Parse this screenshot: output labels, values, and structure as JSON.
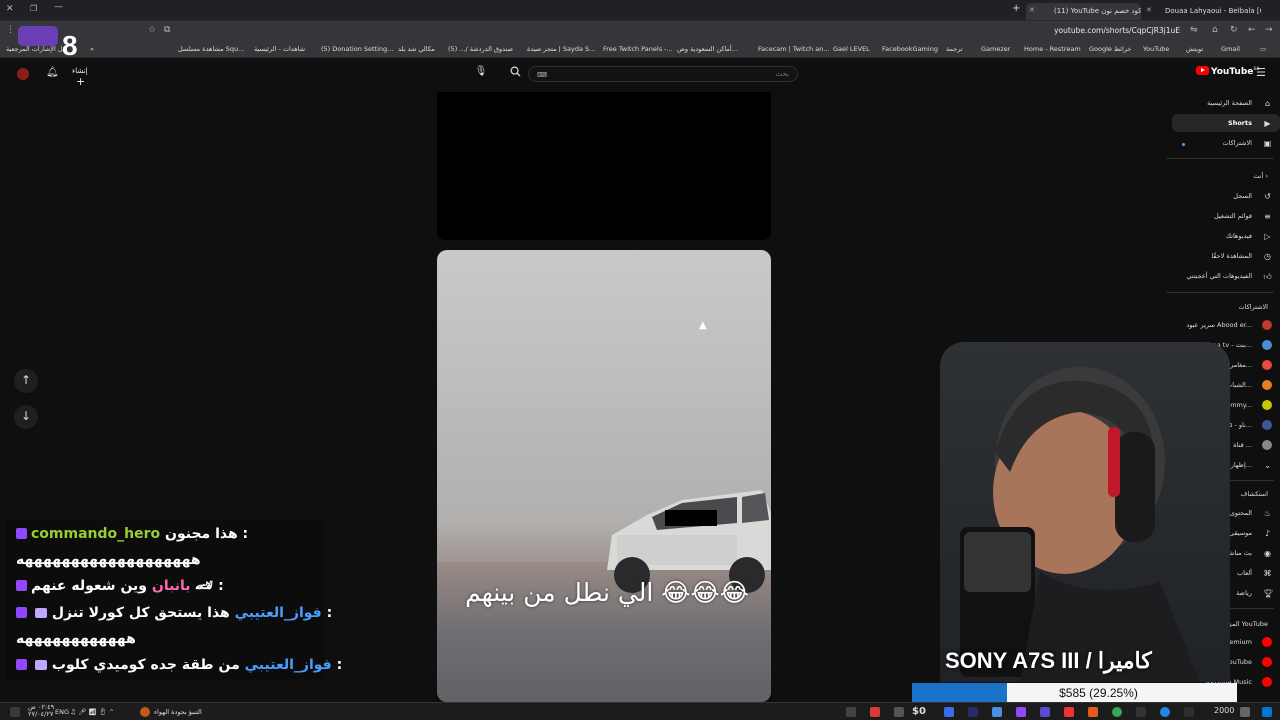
{
  "browser": {
    "tabs": [
      {
        "label": "(11) YouTube كود خصم نون - ",
        "active": true
      },
      {
        "label": "Douaa Lahyaoui - Belbala [Off..."
      }
    ],
    "url": "youtube.com/shorts/CqpCjR3j1uE",
    "bookmarks": [
      "Gmail",
      "تويتش",
      "YouTube",
      "Google خرائط",
      "Home - Restream",
      "Gamezer",
      "ترجمة",
      "FacebookGaming",
      "Gael LEVEL",
      "Facecam | Twitch an...",
      "أماكن السعودية وص...",
      "Free Twitch Panels -...",
      "متجر صيدة | Sayda S...",
      "صندوق الدردشة /... (5)",
      "مكالي شد بلد",
      "(5) Donation Setting...",
      "شاهدات - الرئيسية",
      "مشاهدة مسلسل Squ..."
    ],
    "bookmark_all": "كل الإشارات المرجعية",
    "overlay_counter": "8"
  },
  "youtube": {
    "logo": "YouTube",
    "logo_region": "SA",
    "search_placeholder": "بحث",
    "create_label": "إنشاء",
    "sidebar": {
      "main": [
        {
          "label": "الصفحة الرئيسية",
          "icon": "home-icon"
        },
        {
          "label": "Shorts",
          "icon": "shorts-icon",
          "active": true
        },
        {
          "label": "الاشتراكات",
          "icon": "subscriptions-icon"
        }
      ],
      "you_header": "أنت",
      "you": [
        {
          "label": "السجل",
          "icon": "history-icon"
        },
        {
          "label": "قوائم التشغيل",
          "icon": "playlist-icon"
        },
        {
          "label": "فيديوهاتك",
          "icon": "video-icon"
        },
        {
          "label": "المشاهدة لاحقًا",
          "icon": "clock-icon"
        },
        {
          "label": "الفيديوهات التي أعجبتني",
          "icon": "like-icon"
        }
      ],
      "subs_header": "الاشتراكات",
      "subs": [
        {
          "label": "سرير عبود Abood er...",
          "color": "#c0392b"
        },
        {
          "label": "Bentouna tv - بنت...",
          "color": "#4a90d9"
        },
        {
          "label": "مغامرات...",
          "color": "#e74c3c"
        },
        {
          "label": "الشباب...",
          "color": "#e67e22"
        },
        {
          "label": "mmy...",
          "color": "#c8c800"
        },
        {
          "label": "ناو - ٥...",
          "color": "#3b5998"
        },
        {
          "label": "قناة ...",
          "color": "#888888"
        },
        {
          "label": "إظهار...",
          "color": "#aaaaaa"
        }
      ],
      "explore_header": "استكشاف",
      "explore": [
        "المحتوى الرائج",
        "موسيقى",
        "بث مباشر",
        "ألعاب",
        "رياضة"
      ],
      "more_header": "المزيد من YouTube",
      "more": [
        "YouTube Premium",
        "استوديو YouTube",
        "YouTube Music"
      ]
    }
  },
  "video": {
    "caption": "الي نطل من بينهم 😂😂😂"
  },
  "chat": {
    "messages": [
      {
        "user": "commando_hero",
        "user_color": "#9acd32",
        "text": "هذا مجنون :",
        "cont": "هههههههههههههههههههه"
      },
      {
        "user": "بانبان",
        "user_color": "#ff69b4",
        "text": "وين شعوله عنهم 🏎 :"
      },
      {
        "user": "فواز_العتيبي",
        "user_color": "#4a9eff",
        "text": "هذا يستحق كل كورلا تنزل :",
        "cont": "ههههههههههههه"
      },
      {
        "user": "فواز_العتيبي",
        "user_color": "#4a9eff",
        "text": "من طقة جده كوميدي كلوب :"
      }
    ]
  },
  "stream": {
    "camera_label": "SONY A7S III / كاميرا",
    "goal_text": "$585 (29.25%)",
    "goal_fraction": 0.2925
  },
  "taskbar": {
    "weather": "التنبؤ بجودة الهواء",
    "lang": "ENG",
    "time": "٠٢:٤٩ ص",
    "date": "٢٧/٠٤/٢٧",
    "tray_value": "$0",
    "tray_value2": "2000"
  }
}
